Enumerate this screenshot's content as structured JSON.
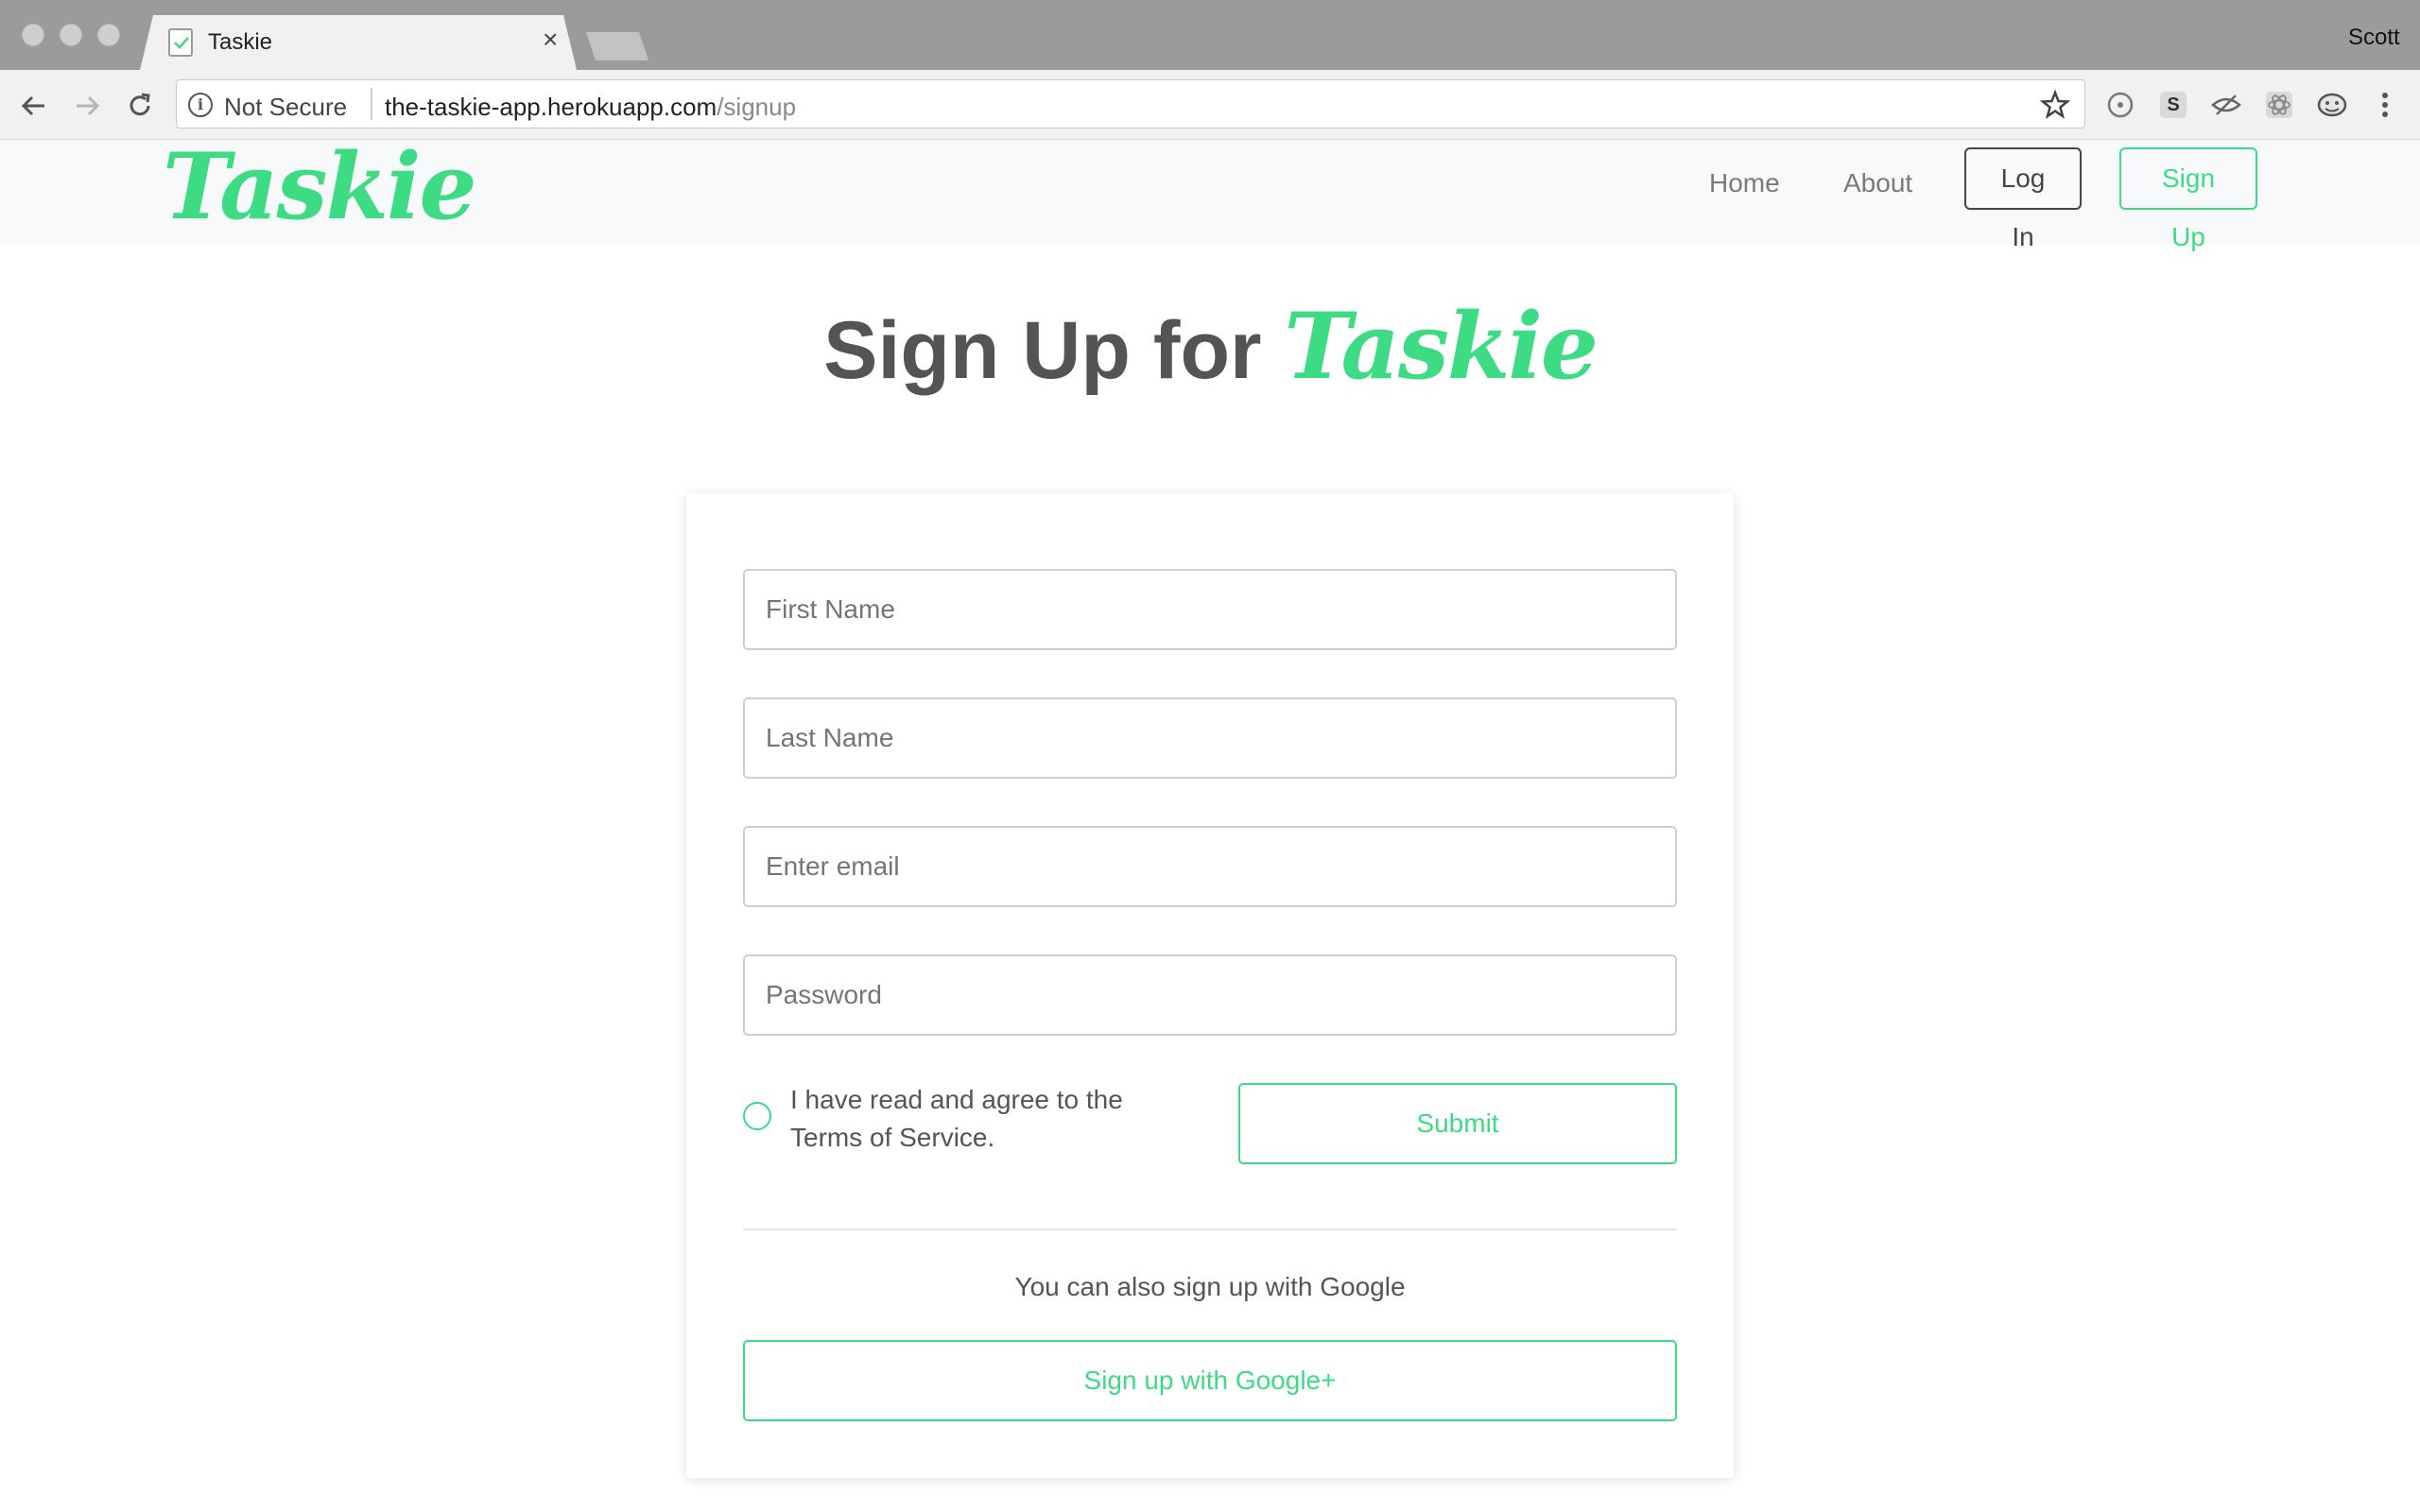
{
  "browser": {
    "tab_title": "Taskie",
    "tab_close": "×",
    "profile_name": "Scott",
    "security_label": "Not Secure",
    "url_host": "the-taskie-app.herokuapp.com",
    "url_path": "/signup"
  },
  "navbar": {
    "brand": "Taskie",
    "links": [
      "Home",
      "About"
    ],
    "login_label": "Log In",
    "signup_label": "Sign Up"
  },
  "page": {
    "heading_prefix": "Sign Up for ",
    "heading_brand": "Taskie"
  },
  "form": {
    "first_name_placeholder": "First Name",
    "last_name_placeholder": "Last Name",
    "email_placeholder": "Enter email",
    "password_placeholder": "Password",
    "tos_text": "I have read and agree to the Terms of Service.",
    "submit_label": "Submit",
    "google_note": "You can also sign up with Google",
    "google_button_label": "Sign up with Google+"
  },
  "colors": {
    "brand_green": "#3ddc84",
    "navbar_bg": "#f8f9fa",
    "text_gray": "#545454"
  }
}
